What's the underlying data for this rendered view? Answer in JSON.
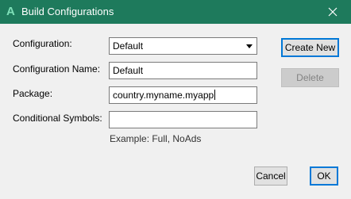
{
  "window": {
    "title": "Build Configurations",
    "app_icon_glyph": "A",
    "app_icon_name": "xamarin-a-icon",
    "titlebar_color": "#1e7a5c"
  },
  "form": {
    "configuration": {
      "label": "Configuration:",
      "value": "Default"
    },
    "configuration_name": {
      "label": "Configuration Name:",
      "value": "Default"
    },
    "package": {
      "label": "Package:",
      "value": "country.myname.myapp"
    },
    "conditional_symbols": {
      "label": "Conditional Symbols:",
      "value": "",
      "example": "Example: Full, NoAds"
    }
  },
  "side_buttons": {
    "create_new": "Create New",
    "delete": "Delete"
  },
  "footer": {
    "cancel": "Cancel",
    "ok": "OK"
  }
}
